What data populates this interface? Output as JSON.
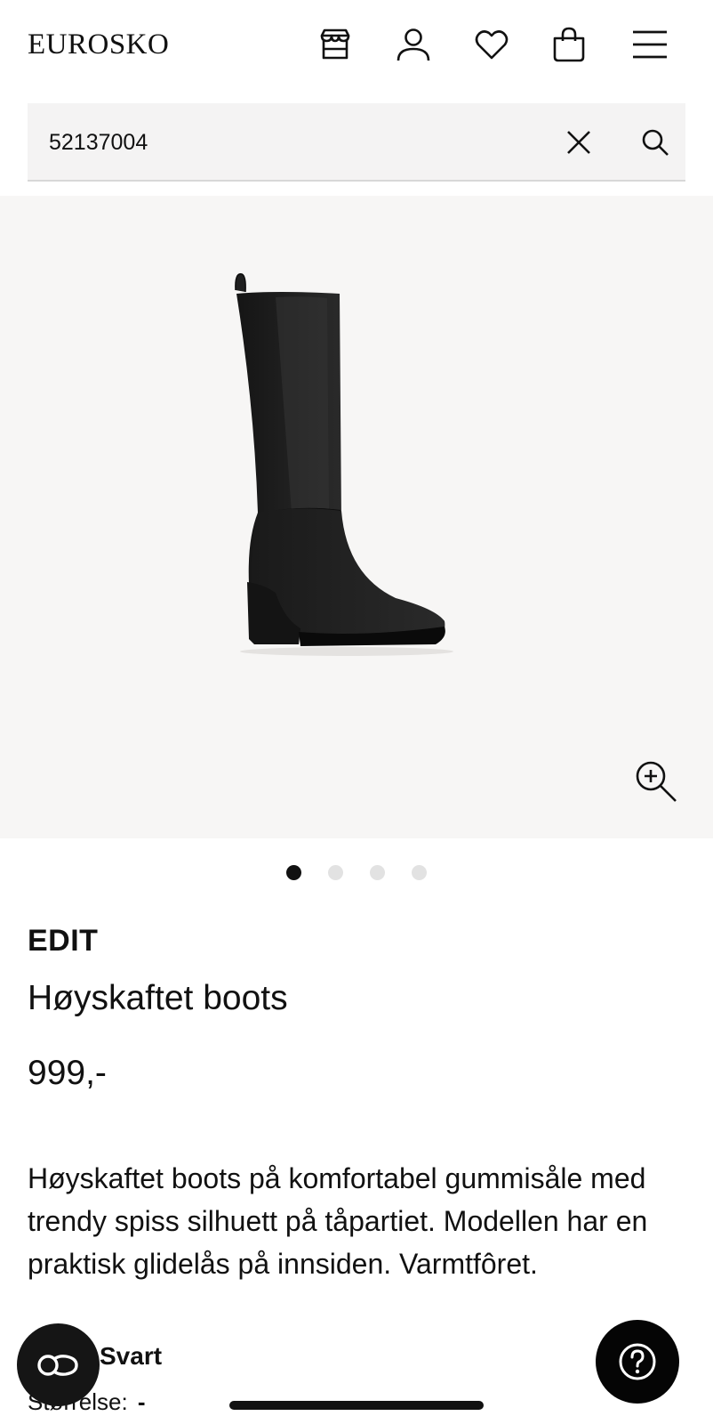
{
  "header": {
    "logo": "EUROSKO",
    "icons": [
      "store-icon",
      "account-icon",
      "wishlist-icon",
      "cart-icon",
      "menu-icon"
    ]
  },
  "search": {
    "value": "52137004",
    "placeholder": ""
  },
  "gallery": {
    "slide_count": 4,
    "active_slide": 1
  },
  "product": {
    "brand": "EDIT",
    "name": "Høyskaftet boots",
    "price": "999,-",
    "description": "Høyskaftet boots på komfortabel gummisåle med trendy spiss silhuett på tåpartiet. Modellen har en praktisk glidelås på innsiden. Varmtfôret.",
    "color_value": "Svart",
    "size_label": "Størrelse:",
    "size_value": "-"
  },
  "colors": {
    "text": "#111111",
    "search_bg": "#f4f3f3",
    "gallery_bg": "#f7f6f5",
    "dot_active": "#111111",
    "dot_inactive": "#e2e2e2"
  }
}
